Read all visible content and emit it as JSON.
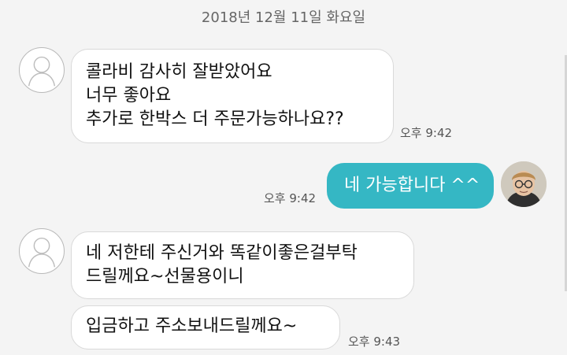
{
  "date_header": "2018년 12월 11일 화요일",
  "messages": [
    {
      "sender": "other",
      "lines": [
        "콜라비 감사히 잘받았어요",
        "너무 좋아요",
        "추가로 한박스 더 주문가능하나요??"
      ],
      "time": "오후 9:42"
    },
    {
      "sender": "me",
      "text": "네 가능합니다 ^^",
      "time": "오후 9:42"
    },
    {
      "sender": "other",
      "lines": [
        "네 저한테 주신거와 똑같이좋은걸부탁",
        "드릴께요~선물용이니"
      ]
    },
    {
      "sender": "other",
      "lines": [
        "입금하고 주소보내드릴께요~"
      ],
      "time": "오후 9:43"
    }
  ]
}
